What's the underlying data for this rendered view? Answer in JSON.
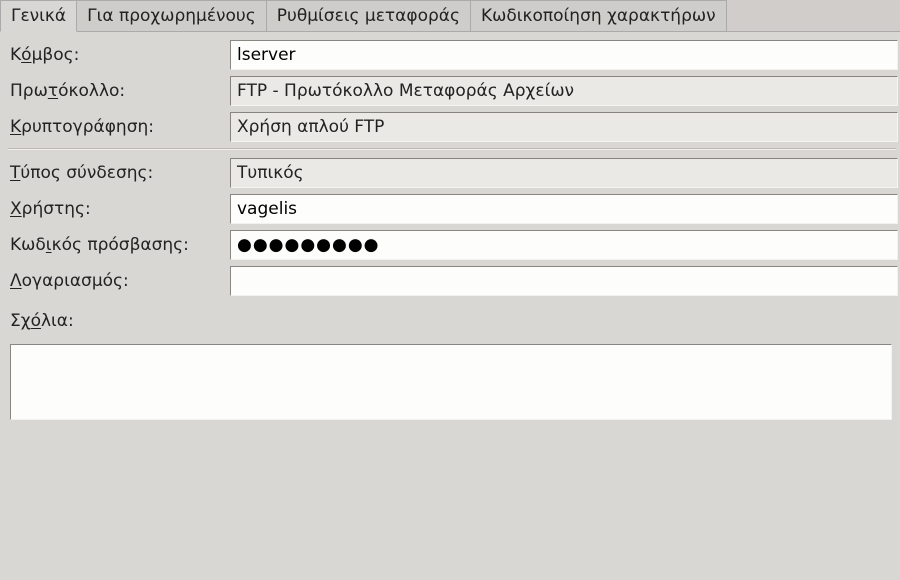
{
  "tabs": [
    {
      "label": "Γενικά",
      "active": true
    },
    {
      "label": "Για προχωρημένους",
      "active": false
    },
    {
      "label": "Ρυθμίσεις μεταφοράς",
      "active": false
    },
    {
      "label": "Κωδικοποίηση χαρακτήρων",
      "active": false
    }
  ],
  "labels": {
    "host": "Κόμβος:",
    "host_u": "ό",
    "host_pre": "Κ",
    "host_post": "μβος:",
    "protocol": "Πρωτόκολλο:",
    "protocol_pre": "Πρω",
    "protocol_u": "τ",
    "protocol_post": "όκολλο:",
    "encryption": "Κρυπτογράφηση:",
    "encryption_pre": "",
    "encryption_u": "Κ",
    "encryption_post": "ρυπτογράφηση:",
    "logon": "Τύπος σύνδεσης:",
    "logon_pre": "",
    "logon_u": "Τ",
    "logon_post": "ύπος σύνδεσης:",
    "user": "Χρήστης:",
    "user_pre": "",
    "user_u": "Χ",
    "user_post": "ρήστης:",
    "password": "Κωδικός πρόσβασης:",
    "password_pre": "Κωδ",
    "password_u": "ι",
    "password_post": "κός πρόσβασης:",
    "account": "Λογαριασμός:",
    "account_pre": "",
    "account_u": "Λ",
    "account_post": "ογαριασμός:",
    "comments": "Σχόλια:",
    "comments_pre": "Σχ",
    "comments_u": "ό",
    "comments_post": "λια:"
  },
  "values": {
    "host": "lserver",
    "protocol": "FTP - Πρωτόκολλο Μεταφοράς Αρχείων",
    "encryption": "Χρήση απλού FTP",
    "logon": "Τυπικός",
    "user": "vagelis",
    "password": "●●●●●●●●●",
    "account": "",
    "comments": ""
  }
}
